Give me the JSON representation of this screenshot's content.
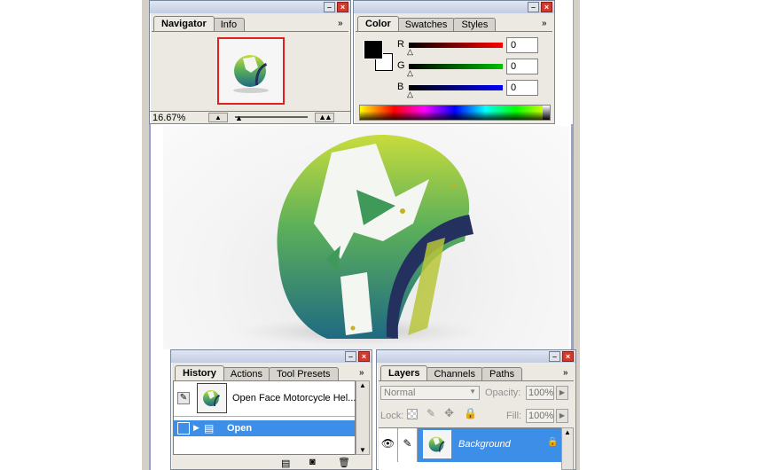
{
  "navigator": {
    "tabs": [
      "Navigator",
      "Info"
    ],
    "zoom": "16.67%"
  },
  "color": {
    "tabs": [
      "Color",
      "Swatches",
      "Styles"
    ],
    "channels": [
      {
        "label": "R",
        "value": "0",
        "color": "#ff0000"
      },
      {
        "label": "G",
        "value": "0",
        "color": "#00c000"
      },
      {
        "label": "B",
        "value": "0",
        "color": "#0000ff"
      }
    ],
    "foreground": "#000000",
    "background": "#ffffff"
  },
  "history": {
    "tabs": [
      "History",
      "Actions",
      "Tool Presets"
    ],
    "snapshot_label": "Open Face Motorcycle Hel...",
    "items": [
      {
        "label": "Open",
        "selected": true
      }
    ]
  },
  "layers": {
    "tabs": [
      "Layers",
      "Channels",
      "Paths"
    ],
    "blend_mode": "Normal",
    "opacity_label": "Opacity:",
    "opacity_value": "100%",
    "lock_label": "Lock:",
    "fill_label": "Fill:",
    "fill_value": "100%",
    "layer_name": "Background"
  },
  "icons": [
    "close-icon",
    "minimize-icon",
    "panel-menu-icon",
    "zoom-out-icon",
    "zoom-in-icon",
    "eye-icon",
    "brush-icon",
    "lock-icon",
    "move-icon",
    "trash-icon",
    "new-document-icon",
    "camera-icon"
  ]
}
